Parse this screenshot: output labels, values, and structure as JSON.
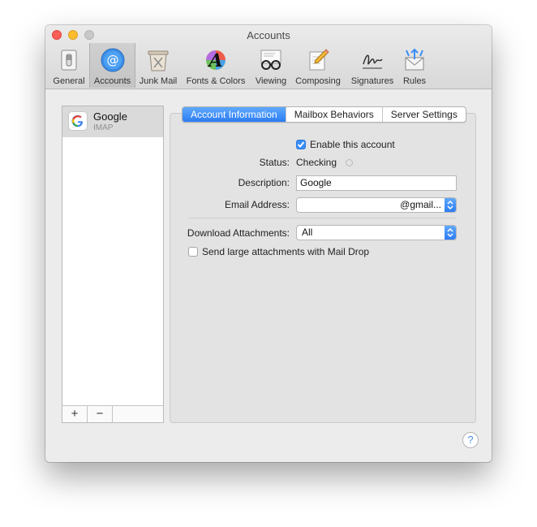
{
  "window": {
    "title": "Accounts"
  },
  "toolbar": {
    "items": [
      {
        "label": "General",
        "icon": "switch-icon"
      },
      {
        "label": "Accounts",
        "icon": "at-sign-icon"
      },
      {
        "label": "Junk Mail",
        "icon": "trash-can-icon"
      },
      {
        "label": "Fonts & Colors",
        "icon": "font-colors-icon"
      },
      {
        "label": "Viewing",
        "icon": "glasses-icon"
      },
      {
        "label": "Composing",
        "icon": "pencil-paper-icon"
      },
      {
        "label": "Signatures",
        "icon": "signature-icon"
      },
      {
        "label": "Rules",
        "icon": "rules-envelope-icon"
      }
    ],
    "selected": "Accounts"
  },
  "sidebar": {
    "accounts": [
      {
        "name": "Google",
        "type": "IMAP",
        "icon": "google-g-icon"
      }
    ],
    "add_label": "+",
    "remove_label": "−"
  },
  "tabs": [
    {
      "label": "Account Information",
      "active": true
    },
    {
      "label": "Mailbox Behaviors",
      "active": false
    },
    {
      "label": "Server Settings",
      "active": false
    }
  ],
  "form": {
    "enable_label": "Enable this account",
    "enable_checked": true,
    "status_label": "Status:",
    "status_value": "Checking",
    "description_label": "Description:",
    "description_value": "Google",
    "email_label": "Email Address:",
    "email_value": "@gmail...",
    "download_label": "Download Attachments:",
    "download_value": "All",
    "maildrop_label": "Send large attachments with Mail Drop",
    "maildrop_checked": false
  },
  "help": {
    "label": "?"
  },
  "colors": {
    "accent": "#2c7cf4",
    "close": "#fc5f57",
    "minimize": "#fdbc2e",
    "maximize": "#c8c8c8"
  }
}
